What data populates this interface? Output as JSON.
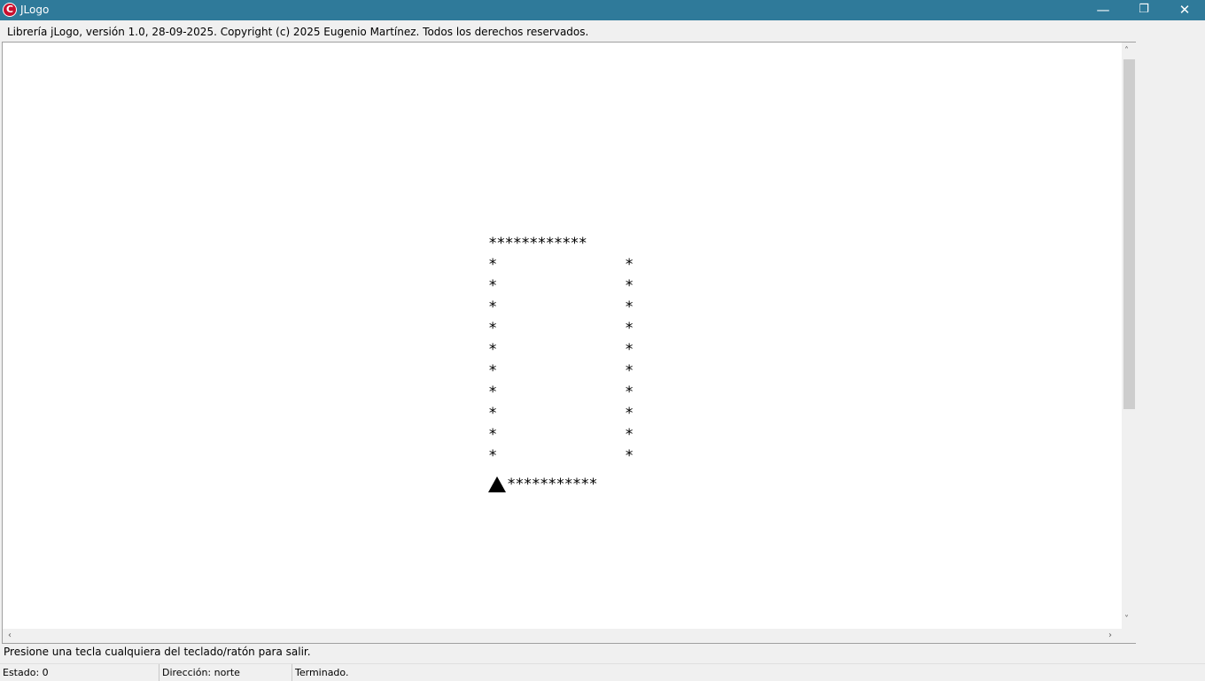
{
  "window": {
    "title": "JLogo",
    "icon_letter": "C",
    "minimize_symbol": "—",
    "restore_symbol": "❐",
    "close_symbol": "✕",
    "accent_color": "#2f7a9a"
  },
  "info_line": "Librería jLogo, versión 1.0, 28-09-2025. Copyright (c) 2025 Eugenio Martínez. Todos los derechos reservados.",
  "drawing": {
    "top_row": "************",
    "bottom_row": "***********",
    "side_char": "*",
    "turtle_icon": "turtle-triangle-icon",
    "turtle_heading": "north"
  },
  "scrollbars": {
    "up_arrow": "˄",
    "down_arrow": "˅",
    "left_arrow": "‹",
    "right_arrow": "›"
  },
  "message": "Presione una tecla cualquiera del teclado/ratón para salir.",
  "status": {
    "estado": "Estado: 0",
    "direccion": "Dirección: norte",
    "resultado": "Terminado."
  }
}
